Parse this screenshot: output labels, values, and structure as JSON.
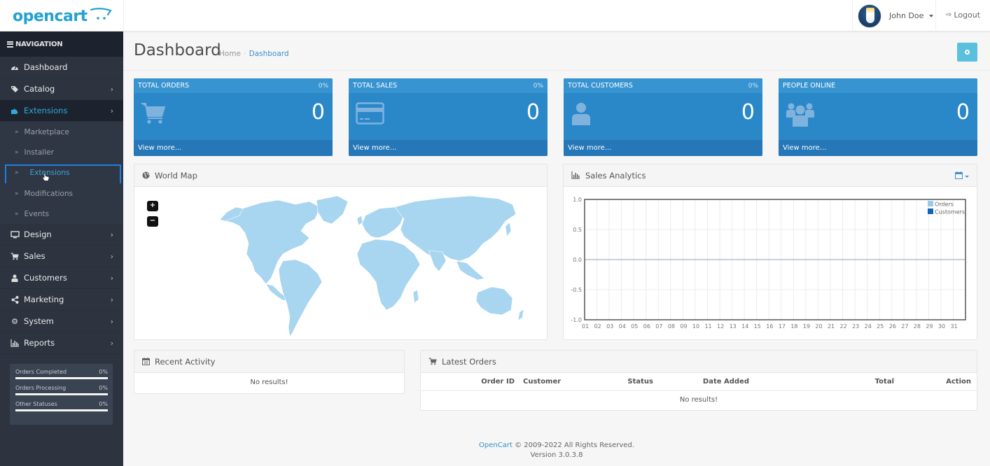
{
  "header": {
    "logo_text": "opencart",
    "user_name": "John Doe",
    "logout_label": "Logout"
  },
  "sidebar": {
    "title": "NAVIGATION",
    "items": [
      {
        "label": "Dashboard",
        "icon": "dashboard-icon",
        "has_children": false
      },
      {
        "label": "Catalog",
        "icon": "tags-icon",
        "has_children": true
      },
      {
        "label": "Extensions",
        "icon": "puzzle-piece-icon",
        "has_children": true,
        "active": true,
        "children": [
          {
            "label": "Marketplace"
          },
          {
            "label": "Installer"
          },
          {
            "label": "Extensions",
            "selected": true
          },
          {
            "label": "Modifications"
          },
          {
            "label": "Events"
          }
        ]
      },
      {
        "label": "Design",
        "icon": "desktop-icon",
        "has_children": true
      },
      {
        "label": "Sales",
        "icon": "shopping-cart-icon",
        "has_children": true
      },
      {
        "label": "Customers",
        "icon": "user-icon",
        "has_children": true
      },
      {
        "label": "Marketing",
        "icon": "share-alt-icon",
        "has_children": true
      },
      {
        "label": "System",
        "icon": "cog-icon",
        "has_children": true
      },
      {
        "label": "Reports",
        "icon": "bar-chart-icon",
        "has_children": true
      }
    ],
    "stats": [
      {
        "label": "Orders Completed",
        "value": "0%",
        "progress": 0
      },
      {
        "label": "Orders Processing",
        "value": "0%",
        "progress": 0
      },
      {
        "label": "Other Statuses",
        "value": "0%",
        "progress": 0
      }
    ]
  },
  "page": {
    "title": "Dashboard",
    "breadcrumb": [
      {
        "label": "Home"
      },
      {
        "label": "Dashboard"
      }
    ],
    "settings_icon": "cog-icon"
  },
  "tiles": [
    {
      "title": "TOTAL ORDERS",
      "percent": "0%",
      "value": "0",
      "icon": "shopping-cart-icon",
      "link": "View more..."
    },
    {
      "title": "TOTAL SALES",
      "percent": "0%",
      "value": "0",
      "icon": "credit-card-icon",
      "link": "View more..."
    },
    {
      "title": "TOTAL CUSTOMERS",
      "percent": "0%",
      "value": "0",
      "icon": "user-icon",
      "link": "View more..."
    },
    {
      "title": "PEOPLE ONLINE",
      "percent": "",
      "value": "0",
      "icon": "users-icon",
      "link": "View more..."
    }
  ],
  "world_map": {
    "title": "World Map",
    "zoom_in": "+",
    "zoom_out": "−",
    "fill_color": "#a8d5f0"
  },
  "sales_analytics": {
    "title": "Sales Analytics",
    "range_icon": "calendar-icon"
  },
  "chart_data": {
    "type": "bar",
    "title": "Sales Analytics",
    "xlabel": "",
    "ylabel": "",
    "categories": [
      "01",
      "02",
      "03",
      "04",
      "05",
      "06",
      "07",
      "08",
      "09",
      "10",
      "11",
      "12",
      "13",
      "14",
      "15",
      "16",
      "17",
      "18",
      "19",
      "20",
      "21",
      "22",
      "23",
      "24",
      "25",
      "26",
      "27",
      "28",
      "29",
      "30",
      "31"
    ],
    "series": [
      {
        "name": "Orders",
        "color": "#9bc9ec",
        "values": [
          0,
          0,
          0,
          0,
          0,
          0,
          0,
          0,
          0,
          0,
          0,
          0,
          0,
          0,
          0,
          0,
          0,
          0,
          0,
          0,
          0,
          0,
          0,
          0,
          0,
          0,
          0,
          0,
          0,
          0,
          0
        ]
      },
      {
        "name": "Customers",
        "color": "#1065b6",
        "values": [
          0,
          0,
          0,
          0,
          0,
          0,
          0,
          0,
          0,
          0,
          0,
          0,
          0,
          0,
          0,
          0,
          0,
          0,
          0,
          0,
          0,
          0,
          0,
          0,
          0,
          0,
          0,
          0,
          0,
          0,
          0
        ]
      }
    ],
    "ylim": [
      -1.0,
      1.0
    ],
    "yticks": [
      "1.0",
      "0.5",
      "0.0",
      "-0.5",
      "-1.0"
    ],
    "grid": true,
    "legend_position": "top-right"
  },
  "recent_activity": {
    "title": "Recent Activity",
    "empty_text": "No results!"
  },
  "latest_orders": {
    "title": "Latest Orders",
    "columns": [
      "Order ID",
      "Customer",
      "Status",
      "Date Added",
      "Total",
      "Action"
    ],
    "rows": [],
    "empty_text": "No results!"
  },
  "footer": {
    "link_text": "OpenCart",
    "copyright": " © 2009-2022 All Rights Reserved.",
    "version": "Version 3.0.3.8"
  }
}
